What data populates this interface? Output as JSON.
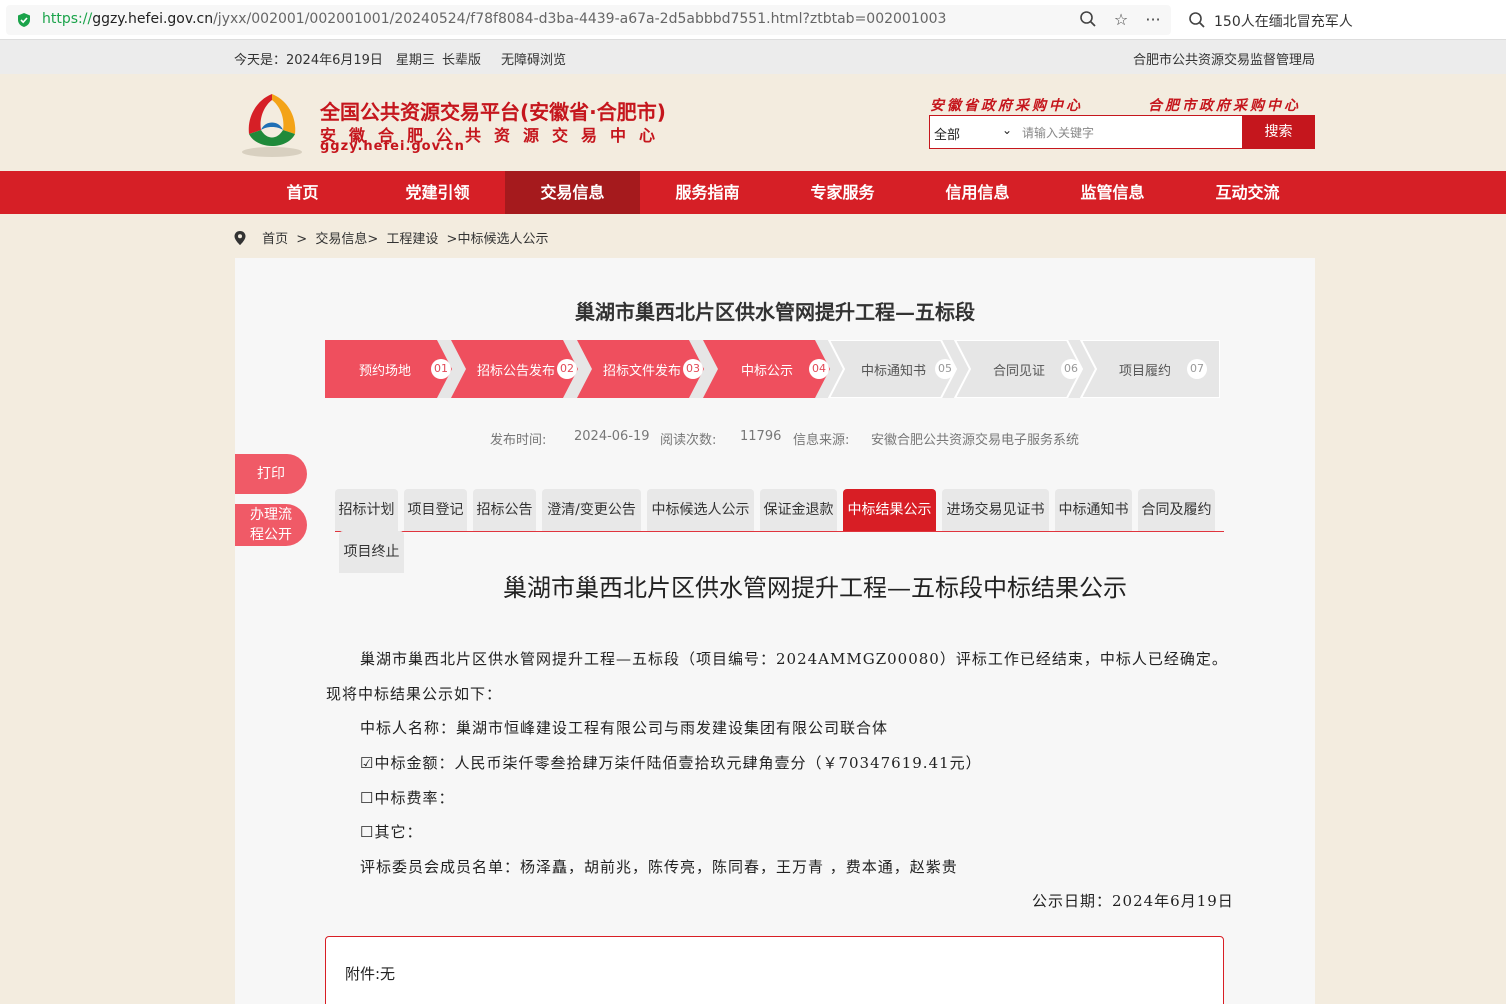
{
  "browser": {
    "url_scheme": "https://",
    "url_host": "ggzy.hefei.gov.cn",
    "url_path": "/jyxx/002001/002001001/20240524/f78f8084-d3ba-4439-a67a-2d5abbbd7551.html?ztbtab=002001003",
    "side_search_text": "150人在缅北冒充军人"
  },
  "topbar": {
    "date": "今天是：2024年6月19日　星期三",
    "elder_mode": "长辈版",
    "accessibility": "无障碍浏览",
    "agency": "合肥市公共资源交易监督管理局"
  },
  "header": {
    "title": "全国公共资源交易平台(安徽省·合肥市)",
    "subtitle": "安徽合肥公共资源交易中心",
    "domain": "ggzy.hefei.gov.cn",
    "link_province": "安徽省政府采购中心",
    "link_city": "合肥市政府采购中心",
    "search_select": "全部",
    "search_placeholder": "请输入关键字",
    "search_button": "搜索"
  },
  "nav": [
    "首页",
    "党建引领",
    "交易信息",
    "服务指南",
    "专家服务",
    "信用信息",
    "监管信息",
    "互动交流"
  ],
  "breadcrumb": {
    "home": "首页",
    "sep1": ">",
    "level1": "交易信息>",
    "level2": "工程建设",
    "level3": ">中标候选人公示"
  },
  "project_title": "巢湖市巢西北片区供水管网提升工程—五标段",
  "steps": [
    {
      "label": "预约场地",
      "num": "01"
    },
    {
      "label": "招标公告发布",
      "num": "02"
    },
    {
      "label": "招标文件发布",
      "num": "03"
    },
    {
      "label": "中标公示",
      "num": "04"
    },
    {
      "label": "中标通知书",
      "num": "05"
    },
    {
      "label": "合同见证",
      "num": "06"
    },
    {
      "label": "项目履约",
      "num": "07"
    }
  ],
  "meta": {
    "publish_label": "发布时间:",
    "publish_value": "2024-06-19",
    "reads_label": "阅读次数:",
    "reads_value": "11796",
    "source_label": "信息来源:",
    "source_value": "安徽合肥公共资源交易电子服务系统"
  },
  "float_buttons": {
    "print": "打印",
    "process_1": "办理流",
    "process_2": "程公开"
  },
  "tabs": [
    "招标计划",
    "项目登记",
    "招标公告",
    "澄清/变更公告",
    "中标候选人公示",
    "保证金退款",
    "中标结果公示",
    "进场交易见证书",
    "中标通知书",
    "合同及履约",
    "项目终止"
  ],
  "document": {
    "title": "巢湖市巢西北片区供水管网提升工程—五标段中标结果公示",
    "intro_1": "巢湖市巢西北片区供水管网提升工程—五标段（项目编号：2024AMMGZ00080）评标工作已经结束，中标人已经确定。",
    "intro_2": "现将中标结果公示如下：",
    "winner": "中标人名称：巢湖市恒峰建设工程有限公司与雨发建设集团有限公司联合体",
    "amount": "☑中标金额：人民币柒仟零叁拾肆万柒仟陆佰壹拾玖元肆角壹分（￥70347619.41元）",
    "rate": "☐中标费率：",
    "other": "☐其它：",
    "committee": "评标委员会成员名单：杨泽矗，胡前兆，陈传亮，陈同春，王万青 ，费本通，赵紫贵",
    "date": "公示日期：2024年6月19日",
    "attachment": "附件:无"
  },
  "colors": {
    "brand_red": "#d61f26",
    "nav_active": "#a51a1d",
    "step_done": "#ef4f5e",
    "step_todo": "#e6e6e6"
  }
}
